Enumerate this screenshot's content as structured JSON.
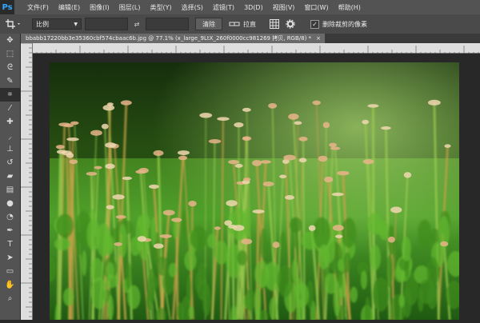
{
  "app": {
    "logo": "Ps"
  },
  "menu": [
    "文件(F)",
    "编辑(E)",
    "图像(I)",
    "图层(L)",
    "类型(Y)",
    "选择(S)",
    "滤镜(T)",
    "3D(D)",
    "视图(V)",
    "窗口(W)",
    "帮助(H)"
  ],
  "options": {
    "ratio": "比例",
    "clear": "清除",
    "straighten_label": "拉直",
    "delete_cropped": "删除裁剪的像素"
  },
  "document": {
    "tab_title": "bbabb17220bb3e35360cbf574cbaac6b.jpg @ 77.1% (x_large_9LtX_260f0000cc981269 拷贝, RGB/8) *",
    "close": "×"
  },
  "tools": [
    "move-tool",
    "rect-marquee-tool",
    "lasso-tool",
    "quick-select-tool",
    "crop-tool",
    "eyedropper-tool",
    "healing-brush-tool",
    "brush-tool",
    "clone-stamp-tool",
    "history-brush-tool",
    "eraser-tool",
    "gradient-tool",
    "blur-tool",
    "dodge-tool",
    "pen-tool",
    "type-tool",
    "path-select-tool",
    "shape-tool",
    "hand-tool",
    "zoom-tool"
  ],
  "colors": {
    "accent": "#31a8ff",
    "panel": "#535353",
    "workspace": "#282828"
  }
}
